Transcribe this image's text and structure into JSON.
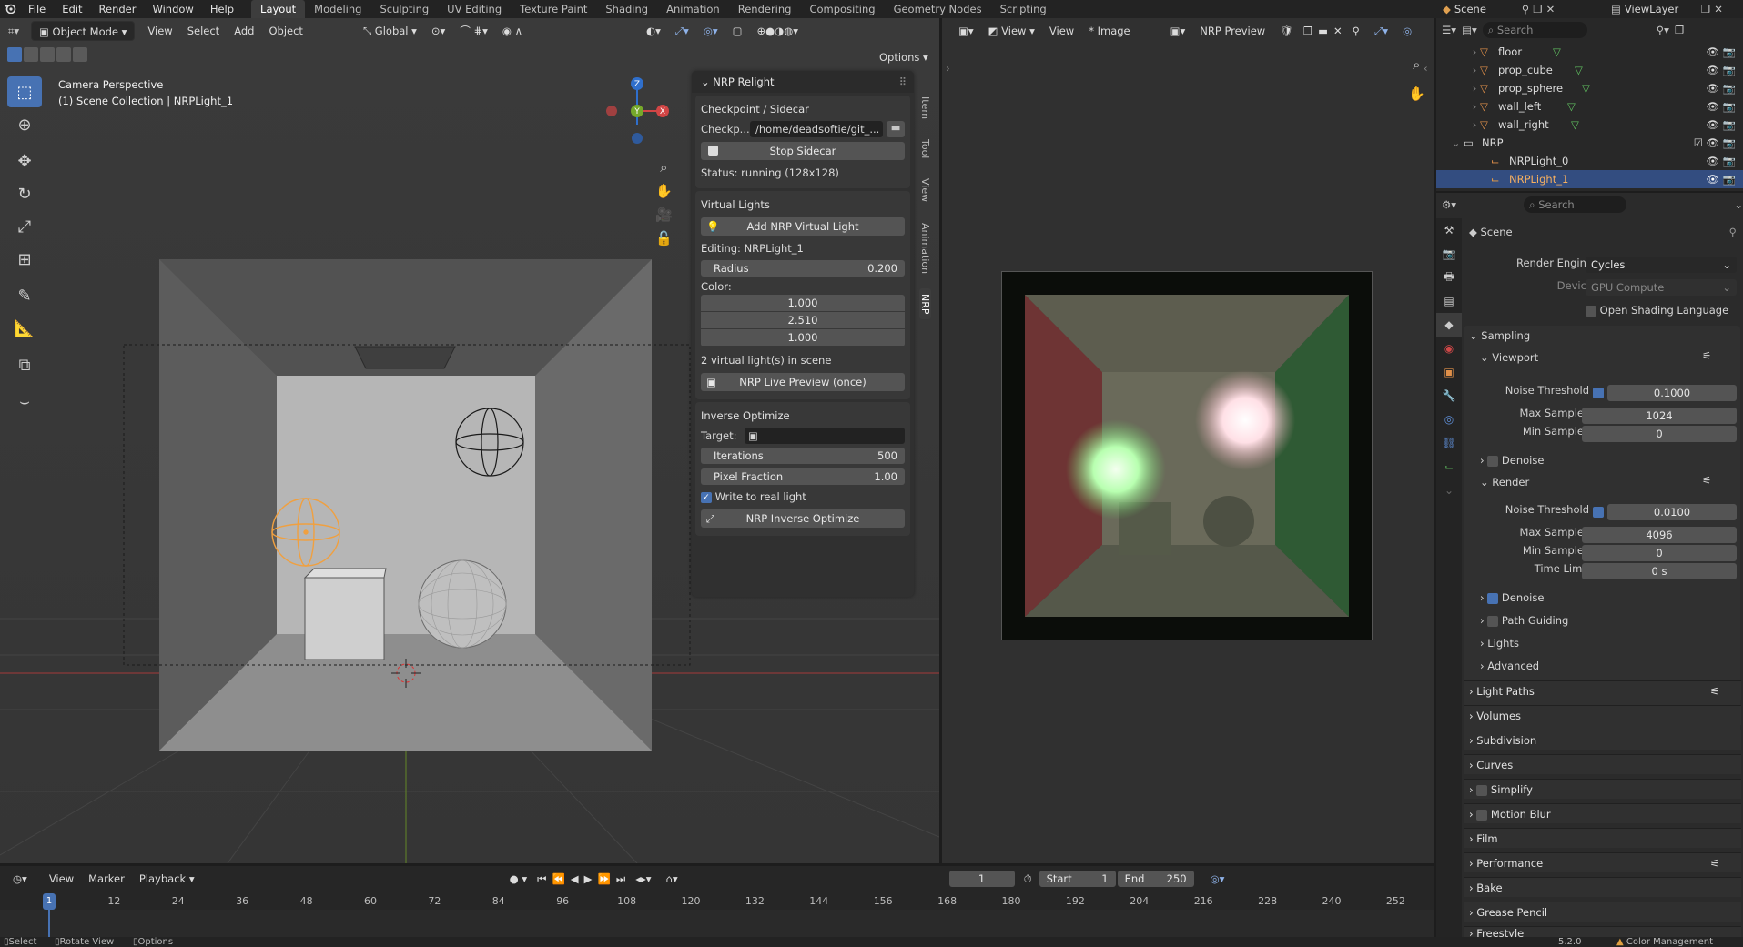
{
  "topbar": {
    "menus": [
      "File",
      "Edit",
      "Render",
      "Window",
      "Help"
    ],
    "workspaces": [
      "Layout",
      "Modeling",
      "Sculpting",
      "UV Editing",
      "Texture Paint",
      "Shading",
      "Animation",
      "Rendering",
      "Compositing",
      "Geometry Nodes",
      "Scripting"
    ],
    "active_workspace": "Layout",
    "scene": "Scene",
    "view_layer": "ViewLayer"
  },
  "viewport": {
    "mode": "Object Mode",
    "menus": [
      "View",
      "Select",
      "Add",
      "Object"
    ],
    "transform_orientation": "Global",
    "options_label": "Options",
    "camera_label": "Camera Perspective",
    "collection_label": "(1) Scene Collection | NRPLight_1",
    "gizmo_axes": [
      "Z",
      "Y",
      "X"
    ],
    "side_tabs": [
      "Item",
      "Tool",
      "View",
      "Animation",
      "NRP"
    ],
    "active_tab": "NRP"
  },
  "nrp_panel": {
    "title": "NRP Relight",
    "checkpoint_section": "Checkpoint / Sidecar",
    "checkpoint_label": "Checkp...",
    "checkpoint_path": "/home/deadsoftie/git_...",
    "stop_sidecar": "Stop Sidecar",
    "status": "Status: running (128x128)",
    "virtual_lights_section": "Virtual Lights",
    "add_light": "Add NRP Virtual Light",
    "editing": "Editing: NRPLight_1",
    "radius_label": "Radius",
    "radius_value": "0.200",
    "color_label": "Color:",
    "color_values": [
      "1.000",
      "2.510",
      "1.000"
    ],
    "light_count": "2 virtual light(s) in scene",
    "live_preview": "NRP Live Preview (once)",
    "inverse_section": "Inverse Optimize",
    "target_label": "Target:",
    "iterations_label": "Iterations",
    "iterations_value": "500",
    "pixel_fraction_label": "Pixel Fraction",
    "pixel_fraction_value": "1.00",
    "write_real_light": "Write to real light",
    "write_real_light_checked": true,
    "inverse_button": "NRP Inverse Optimize"
  },
  "image_editor": {
    "menus": [
      "View",
      "View",
      "* Image"
    ],
    "image_name": "NRP Preview"
  },
  "outliner": {
    "search_placeholder": "Search",
    "items": [
      {
        "name": "floor",
        "indent": 2,
        "type": "mesh"
      },
      {
        "name": "prop_cube",
        "indent": 2,
        "type": "mesh"
      },
      {
        "name": "prop_sphere",
        "indent": 2,
        "type": "mesh"
      },
      {
        "name": "wall_left",
        "indent": 2,
        "type": "mesh"
      },
      {
        "name": "wall_right",
        "indent": 2,
        "type": "mesh"
      },
      {
        "name": "NRP",
        "indent": 1,
        "type": "collection"
      },
      {
        "name": "NRPLight_0",
        "indent": 2,
        "type": "empty"
      },
      {
        "name": "NRPLight_1",
        "indent": 2,
        "type": "empty",
        "selected": true
      }
    ]
  },
  "properties": {
    "search_placeholder": "Search",
    "context": "Scene",
    "render_engine_label": "Render Engine",
    "render_engine": "Cycles",
    "device_label": "Device",
    "device": "GPU Compute",
    "osl_label": "Open Shading Language",
    "sampling": "Sampling",
    "viewport": "Viewport",
    "noise_threshold_label": "Noise Threshold",
    "vp_noise_threshold": "0.1000",
    "max_samples_label": "Max Samples",
    "vp_max_samples": "1024",
    "min_samples_label": "Min Samples",
    "vp_min_samples": "0",
    "denoise": "Denoise",
    "render": "Render",
    "r_noise_threshold": "0.0100",
    "r_max_samples": "4096",
    "r_min_samples": "0",
    "time_limit_label": "Time Limit",
    "time_limit": "0 s",
    "sub_sections": [
      "Path Guiding",
      "Lights",
      "Advanced"
    ],
    "sections": [
      "Light Paths",
      "Volumes",
      "Subdivision",
      "Curves",
      "Simplify",
      "Motion Blur",
      "Film",
      "Performance",
      "Bake",
      "Grease Pencil",
      "Freestyle"
    ]
  },
  "timeline": {
    "menus": [
      "View",
      "Marker",
      "Playback"
    ],
    "current_frame": "1",
    "start_label": "Start",
    "start": "1",
    "end_label": "End",
    "end": "250",
    "ticks": [
      "1",
      "12",
      "24",
      "36",
      "48",
      "60",
      "72",
      "84",
      "96",
      "108",
      "120",
      "132",
      "144",
      "156",
      "168",
      "180",
      "192",
      "204",
      "216",
      "228",
      "240",
      "252"
    ]
  },
  "statusbar": {
    "items": [
      "Select",
      "Rotate View",
      "Options"
    ],
    "version": "5.2.0",
    "color_management": "Color Management"
  },
  "colors": {
    "accent": "#4772b3",
    "selection": "#334d80",
    "object_orange": "#f0a040"
  }
}
